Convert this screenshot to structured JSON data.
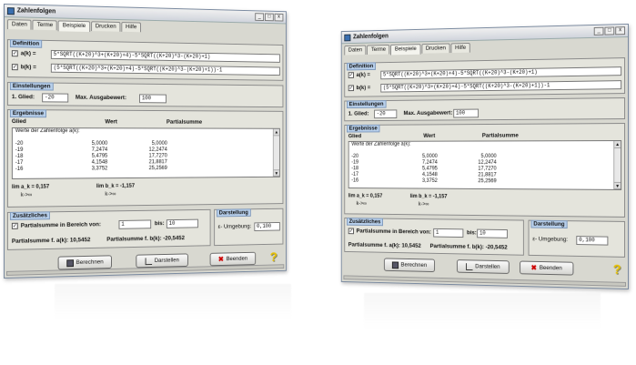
{
  "window": {
    "title": "Zahlenfolgen"
  },
  "tabs": [
    "Daten",
    "Terme",
    "Beispiele",
    "Drucken",
    "Hilfe"
  ],
  "definition": {
    "label": "Definition",
    "a_label": "a(k) =",
    "a_value": "5*SQRT((K+20)^3+(K+20)+4)-5*SQRT((K+20)^3-(K+20)+1)",
    "b_label": "b(k) =",
    "b_value": "(5*SQRT((K+20)^3+(K+20)+4)-5*SQRT((K+20)^3-(K+20)+1))-1",
    "a_checked": "✓",
    "b_checked": "✓"
  },
  "einstellungen": {
    "label": "Einstellungen",
    "first_label": "1. Glied:",
    "first_value": "-20",
    "max_label": "Max. Ausgabewert:",
    "max_value": "100"
  },
  "ergebnisse": {
    "label": "Ergebnisse",
    "col_glied": "Glied",
    "col_wert": "Wert",
    "col_partial": "Partialsumme",
    "list_header": "Werte der Zahlenfolge a(k):",
    "rows": [
      {
        "glied": "-20",
        "wert": "5,0000",
        "partial": "5,0000"
      },
      {
        "glied": "-19",
        "wert": "7,2474",
        "partial": "12,2474"
      },
      {
        "glied": "-18",
        "wert": "5,4795",
        "partial": "17,7270"
      },
      {
        "glied": "-17",
        "wert": "4,1548",
        "partial": "21,8817"
      },
      {
        "glied": "-16",
        "wert": "3,3752",
        "partial": "25,2569"
      }
    ],
    "lim_a": "lim a_k = 0,157",
    "lim_a_sub": "k->∞",
    "lim_b": "lim b_k = -1,157",
    "lim_b_sub": "k->∞"
  },
  "zusaetzliches": {
    "label": "Zusätzliches",
    "checkbox_label": "Partialsumme in Bereich von:",
    "checked": "✓",
    "from_value": "1",
    "bis_label": "bis:",
    "to_value": "10",
    "partial_a": "Partialsumme f. a(k): 10,5452",
    "partial_b": "Partialsumme f. b(k): -20,5452"
  },
  "darstellung": {
    "label": "Darstellung",
    "umgebung_label": "ε- Umgebung:",
    "umgebung_left": "0,100",
    "umgebung_right": "0,100"
  },
  "buttons": {
    "berechnen": "Berechnen",
    "darstellen": "Darstellen",
    "beenden": "Beenden"
  },
  "icons": {
    "help": "?",
    "minimize": "_",
    "maximize": "□",
    "close": "x"
  },
  "colors": {
    "group_label_bg": "#b8d0ec",
    "window_bg": "#d8d8d0"
  }
}
